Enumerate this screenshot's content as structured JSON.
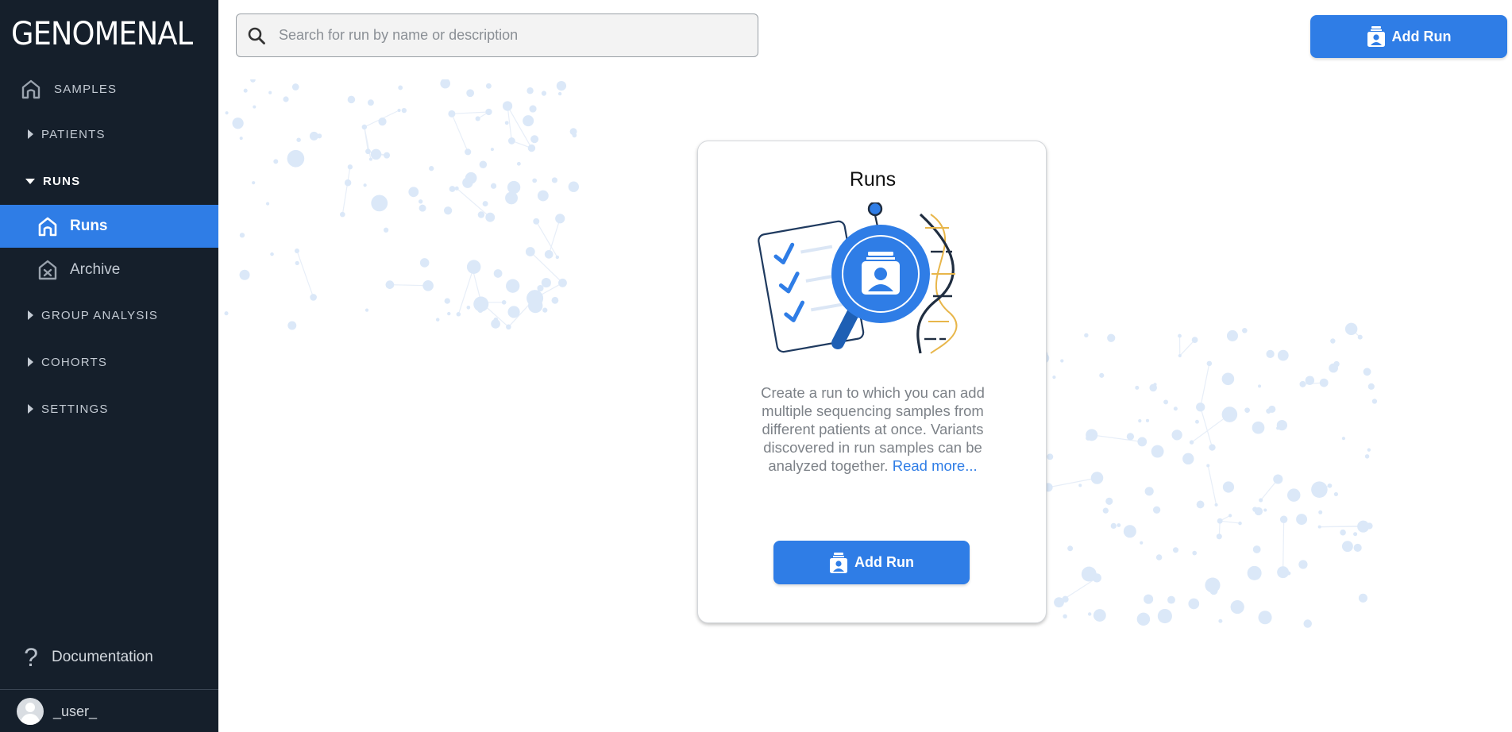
{
  "app": {
    "logo_text": "GENOMENAL"
  },
  "sidebar": {
    "samples": {
      "label": "SAMPLES",
      "icon": "home-icon"
    },
    "patients": {
      "label": "PATIENTS"
    },
    "runs": {
      "label": "RUNS",
      "children": [
        {
          "label": "Runs",
          "icon": "home-icon"
        },
        {
          "label": "Archive",
          "icon": "archive-x-icon"
        }
      ]
    },
    "group_analysis": {
      "label": "GROUP ANALYSIS"
    },
    "cohorts": {
      "label": "COHORTS"
    },
    "settings": {
      "label": "SETTINGS"
    },
    "documentation": {
      "label": "Documentation",
      "icon": "question-icon"
    },
    "user": {
      "name": "_user_"
    }
  },
  "header": {
    "search": {
      "placeholder": "Search for run by name or description",
      "value": ""
    },
    "add_run_label": "Add Run"
  },
  "empty_state": {
    "title": "Runs",
    "description": "Create a run to which you can add multiple sequencing samples from different patients at once. Variants discovered in run samples can be analyzed together.",
    "link_text": "Read more...",
    "button_label": "Add Run"
  },
  "colors": {
    "accent": "#2f7de6",
    "sidebar_bg": "#151f2b",
    "network": "#dbe8f8"
  }
}
